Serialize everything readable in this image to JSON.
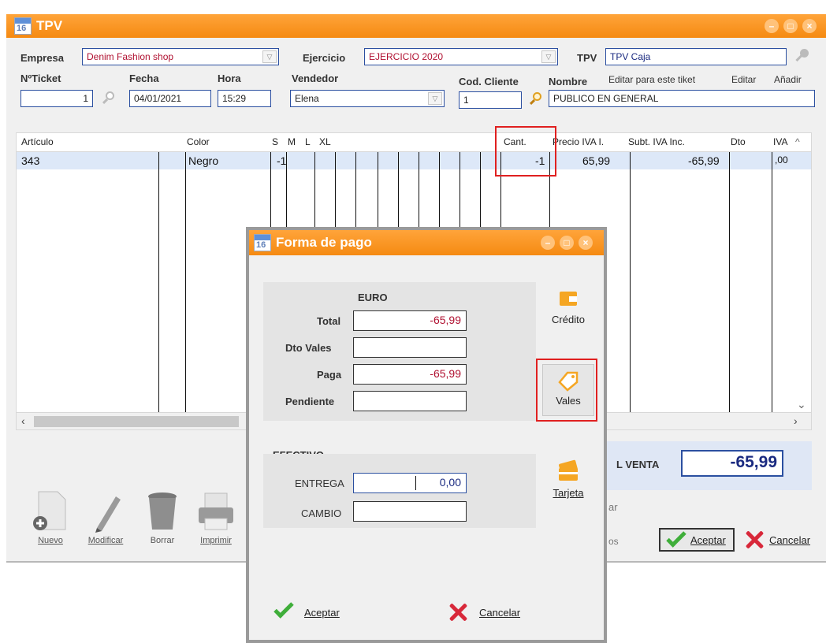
{
  "window": {
    "title": "TPV"
  },
  "header": {
    "empresa_label": "Empresa",
    "empresa_value": "Denim Fashion shop",
    "ejercicio_label": "Ejercicio",
    "ejercicio_value": "EJERCICIO 2020",
    "tpv_label": "TPV",
    "tpv_value": "TPV Caja",
    "nticket_label": "NºTicket",
    "nticket_value": "1",
    "fecha_label": "Fecha",
    "fecha_value": "04/01/2021",
    "hora_label": "Hora",
    "hora_value": "15:29",
    "vendedor_label": "Vendedor",
    "vendedor_value": "Elena",
    "codcliente_label": "Cod. Cliente",
    "codcliente_value": "1",
    "nombre_label": "Nombre",
    "editar_tiket_link": "Editar para este tiket",
    "editar_link": "Editar",
    "anadir_link": "Añadir",
    "nombre_value": "PUBLICO EN GENERAL"
  },
  "grid": {
    "columns": [
      "Artículo",
      "Color",
      "S",
      "M",
      "L",
      "XL",
      "Cant.",
      "Precio IVA I.",
      "Subt. IVA Inc.",
      "Dto",
      "IVA"
    ],
    "row": {
      "articulo": "343",
      "color": "Negro",
      "s": "-1",
      "cant": "-1",
      "precio": "65,99",
      "subtotal": "-65,99",
      "iva": ",00"
    }
  },
  "total": {
    "label": "L VENTA",
    "value": "-65,99"
  },
  "toolbar": {
    "nuevo": "Nuevo",
    "modificar": "Modificar",
    "borrar": "Borrar",
    "imprimir": "Imprimir",
    "partial_ar": "ar",
    "partial_os": "os"
  },
  "main_buttons": {
    "aceptar": "Aceptar",
    "cancelar": "Cancelar"
  },
  "dialog": {
    "title": "Forma de pago",
    "euro_section": "EURO",
    "total_label": "Total",
    "total_value": "-65,99",
    "dto_vales_label": "Dto Vales",
    "dto_vales_value": "",
    "paga_label": "Paga",
    "paga_value": "-65,99",
    "pendiente_label": "Pendiente",
    "pendiente_value": "",
    "efectivo_section": "EFECTIVO",
    "entrega_label": "ENTREGA",
    "entrega_value": "0,00",
    "cambio_label": "CAMBIO",
    "cambio_value": "",
    "credito_label": "Crédito",
    "vales_label": "Vales",
    "tarjeta_label": "Tarjeta",
    "aceptar": "Aceptar",
    "cancelar": "Cancelar"
  },
  "colors": {
    "title_orange": "#f58a12",
    "field_border": "#2b4fa0",
    "highlight_red": "#e02020",
    "accept_green": "#3fae3a",
    "cancel_red": "#d8283a"
  }
}
